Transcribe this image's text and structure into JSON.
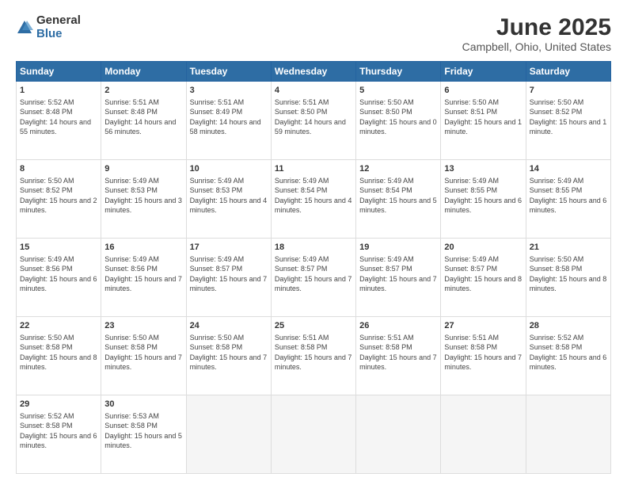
{
  "logo": {
    "general": "General",
    "blue": "Blue"
  },
  "title": "June 2025",
  "subtitle": "Campbell, Ohio, United States",
  "weekdays": [
    "Sunday",
    "Monday",
    "Tuesday",
    "Wednesday",
    "Thursday",
    "Friday",
    "Saturday"
  ],
  "weeks": [
    [
      {
        "day": 1,
        "sunrise": "5:52 AM",
        "sunset": "8:48 PM",
        "daylight": "14 hours and 55 minutes."
      },
      {
        "day": 2,
        "sunrise": "5:51 AM",
        "sunset": "8:48 PM",
        "daylight": "14 hours and 56 minutes."
      },
      {
        "day": 3,
        "sunrise": "5:51 AM",
        "sunset": "8:49 PM",
        "daylight": "14 hours and 58 minutes."
      },
      {
        "day": 4,
        "sunrise": "5:51 AM",
        "sunset": "8:50 PM",
        "daylight": "14 hours and 59 minutes."
      },
      {
        "day": 5,
        "sunrise": "5:50 AM",
        "sunset": "8:50 PM",
        "daylight": "15 hours and 0 minutes."
      },
      {
        "day": 6,
        "sunrise": "5:50 AM",
        "sunset": "8:51 PM",
        "daylight": "15 hours and 1 minute."
      },
      {
        "day": 7,
        "sunrise": "5:50 AM",
        "sunset": "8:52 PM",
        "daylight": "15 hours and 1 minute."
      }
    ],
    [
      {
        "day": 8,
        "sunrise": "5:50 AM",
        "sunset": "8:52 PM",
        "daylight": "15 hours and 2 minutes."
      },
      {
        "day": 9,
        "sunrise": "5:49 AM",
        "sunset": "8:53 PM",
        "daylight": "15 hours and 3 minutes."
      },
      {
        "day": 10,
        "sunrise": "5:49 AM",
        "sunset": "8:53 PM",
        "daylight": "15 hours and 4 minutes."
      },
      {
        "day": 11,
        "sunrise": "5:49 AM",
        "sunset": "8:54 PM",
        "daylight": "15 hours and 4 minutes."
      },
      {
        "day": 12,
        "sunrise": "5:49 AM",
        "sunset": "8:54 PM",
        "daylight": "15 hours and 5 minutes."
      },
      {
        "day": 13,
        "sunrise": "5:49 AM",
        "sunset": "8:55 PM",
        "daylight": "15 hours and 6 minutes."
      },
      {
        "day": 14,
        "sunrise": "5:49 AM",
        "sunset": "8:55 PM",
        "daylight": "15 hours and 6 minutes."
      }
    ],
    [
      {
        "day": 15,
        "sunrise": "5:49 AM",
        "sunset": "8:56 PM",
        "daylight": "15 hours and 6 minutes."
      },
      {
        "day": 16,
        "sunrise": "5:49 AM",
        "sunset": "8:56 PM",
        "daylight": "15 hours and 7 minutes."
      },
      {
        "day": 17,
        "sunrise": "5:49 AM",
        "sunset": "8:57 PM",
        "daylight": "15 hours and 7 minutes."
      },
      {
        "day": 18,
        "sunrise": "5:49 AM",
        "sunset": "8:57 PM",
        "daylight": "15 hours and 7 minutes."
      },
      {
        "day": 19,
        "sunrise": "5:49 AM",
        "sunset": "8:57 PM",
        "daylight": "15 hours and 7 minutes."
      },
      {
        "day": 20,
        "sunrise": "5:49 AM",
        "sunset": "8:57 PM",
        "daylight": "15 hours and 8 minutes."
      },
      {
        "day": 21,
        "sunrise": "5:50 AM",
        "sunset": "8:58 PM",
        "daylight": "15 hours and 8 minutes."
      }
    ],
    [
      {
        "day": 22,
        "sunrise": "5:50 AM",
        "sunset": "8:58 PM",
        "daylight": "15 hours and 8 minutes."
      },
      {
        "day": 23,
        "sunrise": "5:50 AM",
        "sunset": "8:58 PM",
        "daylight": "15 hours and 7 minutes."
      },
      {
        "day": 24,
        "sunrise": "5:50 AM",
        "sunset": "8:58 PM",
        "daylight": "15 hours and 7 minutes."
      },
      {
        "day": 25,
        "sunrise": "5:51 AM",
        "sunset": "8:58 PM",
        "daylight": "15 hours and 7 minutes."
      },
      {
        "day": 26,
        "sunrise": "5:51 AM",
        "sunset": "8:58 PM",
        "daylight": "15 hours and 7 minutes."
      },
      {
        "day": 27,
        "sunrise": "5:51 AM",
        "sunset": "8:58 PM",
        "daylight": "15 hours and 7 minutes."
      },
      {
        "day": 28,
        "sunrise": "5:52 AM",
        "sunset": "8:58 PM",
        "daylight": "15 hours and 6 minutes."
      }
    ],
    [
      {
        "day": 29,
        "sunrise": "5:52 AM",
        "sunset": "8:58 PM",
        "daylight": "15 hours and 6 minutes."
      },
      {
        "day": 30,
        "sunrise": "5:53 AM",
        "sunset": "8:58 PM",
        "daylight": "15 hours and 5 minutes."
      },
      null,
      null,
      null,
      null,
      null
    ]
  ]
}
